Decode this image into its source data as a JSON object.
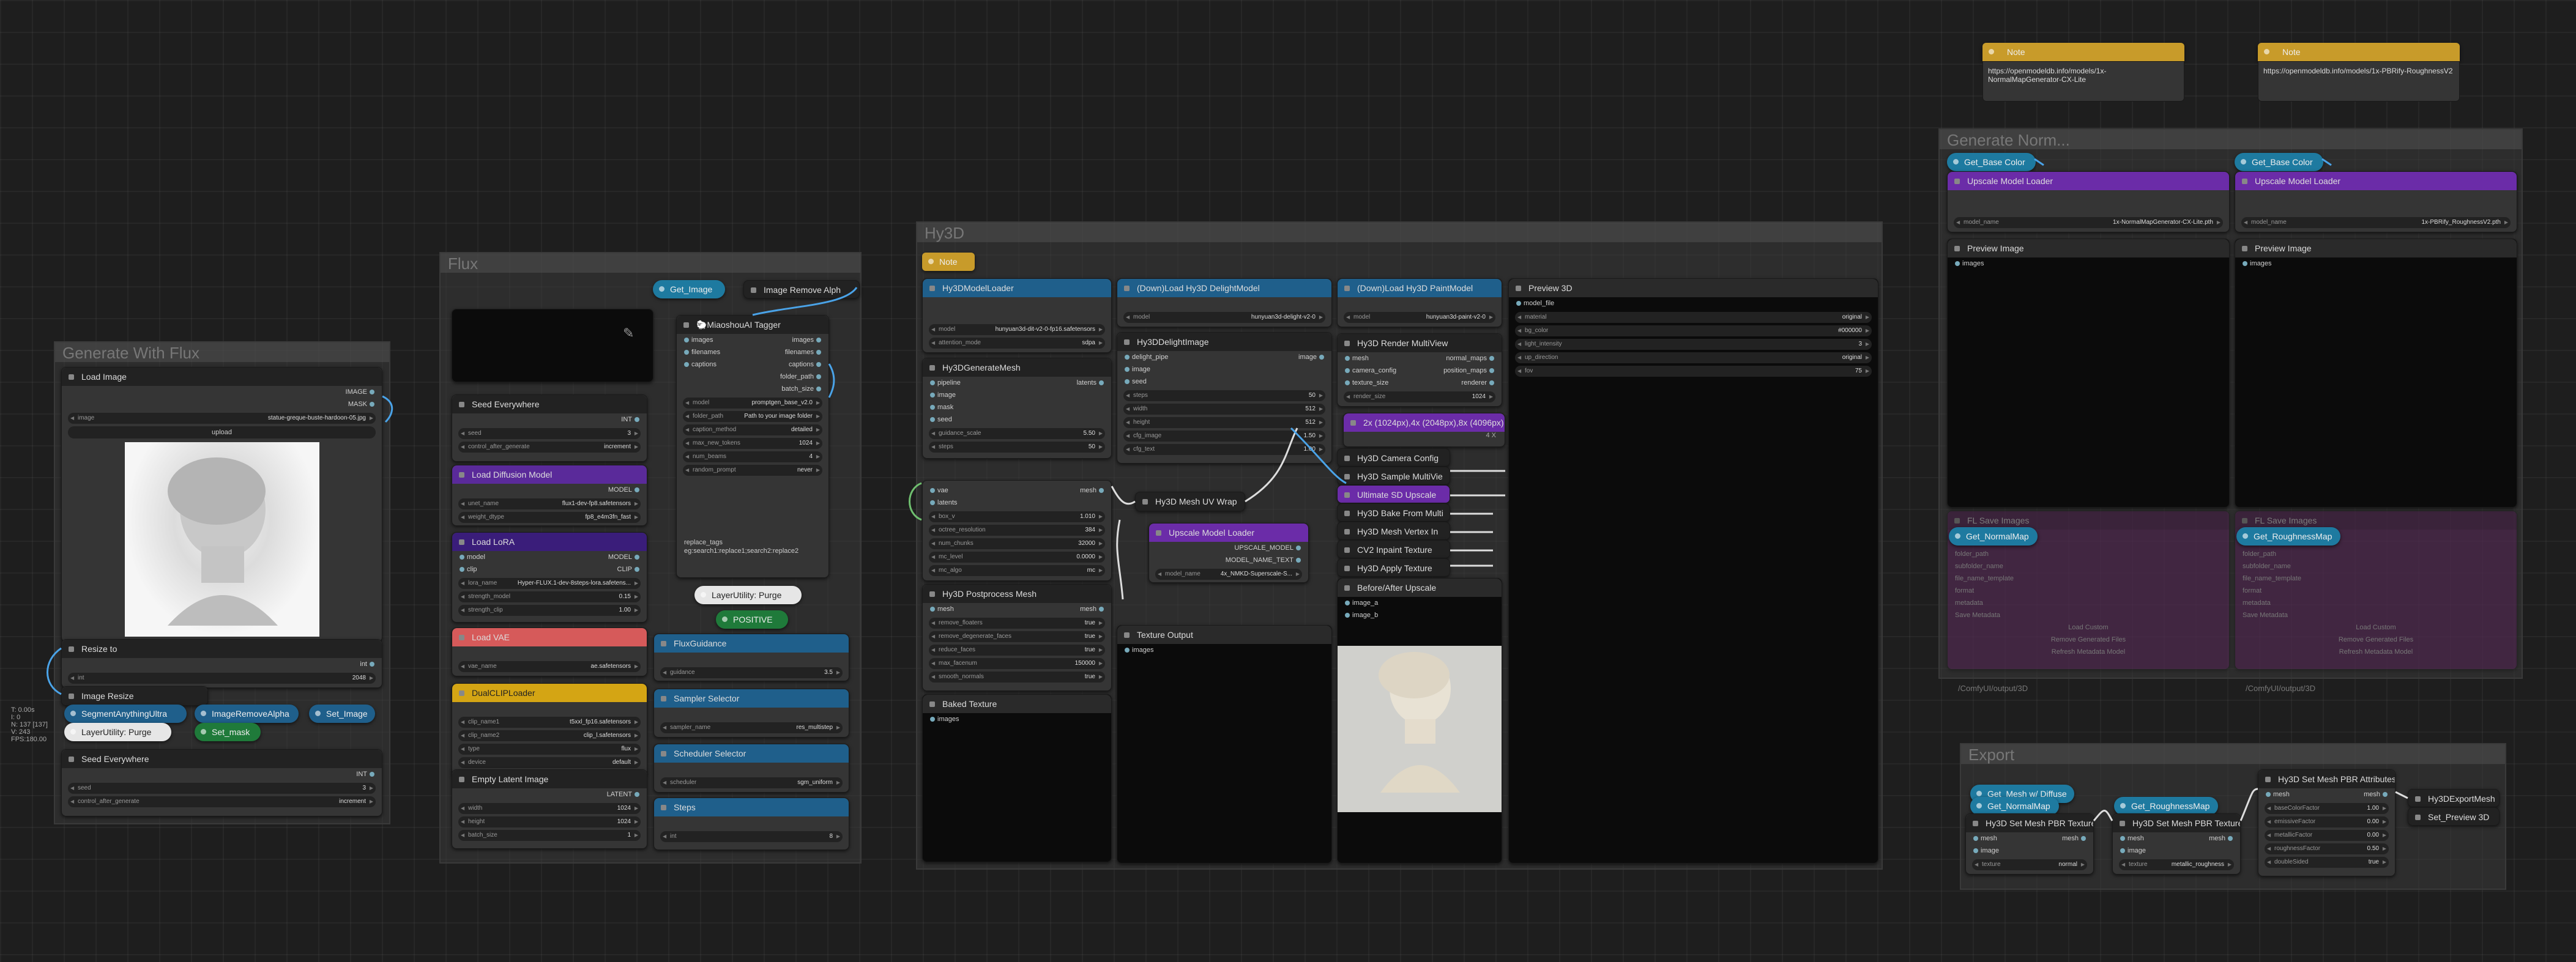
{
  "perf": [
    "T: 0.00s",
    "I: 0",
    "N: 137 [137]",
    "V: 243",
    "FPS:180.00"
  ],
  "groups": {
    "generate": "Generate With Flux",
    "flux": "Flux",
    "hy3d": "Hy3D",
    "normal": "Generate Norm...",
    "export": "Export"
  },
  "notes": {
    "badge": "Note",
    "note1": "https://openmodeldb.info/models/1x-NormalMapGenerator-CX-Lite",
    "note2": "https://openmodeldb.info/models/1x-PBRify-RoughnessV2"
  },
  "load_image": {
    "title": "Load Image",
    "out1": "IMAGE",
    "out2": "MASK",
    "widget_key": "image",
    "widget_val": "statue-greque-buste-hardoon-05.jpg",
    "upload": "upload"
  },
  "resize": {
    "title": "Resize to",
    "out": "int",
    "key": "int",
    "val": "2048"
  },
  "image_resize": {
    "title": "Image Resize"
  },
  "pills": {
    "seg": "SegmentAnythingUltra",
    "rembg": "ImageRemoveAlpha",
    "set_image": "Set_Image",
    "set_mask": "Set_mask",
    "purge1": "LayerUtility: Purge",
    "get_image": "Get_Image",
    "remove_alpha": "Image Remove Alph",
    "purge2": "LayerUtility: Purge",
    "positive": "POSITIVE",
    "get_base1": "Get_Base Color",
    "get_base2": "Get_Base Color",
    "get_normal": "Get_NormalMap",
    "get_rough": "Get_RoughnessMap",
    "path1": "/ComfyUI/output/3D",
    "path2": "/ComfyUI/output/3D",
    "get_mesh": "Get_Mesh w/ Diffuse",
    "get_normal2": "Get_NormalMap",
    "get_rough2": "Get_RoughnessMap",
    "export_mesh": "Hy3DExportMesh",
    "set_preview": "Set_Preview 3D"
  },
  "seed1": {
    "title": "Seed Everywhere",
    "out": "INT",
    "w1k": "seed",
    "w1v": "3",
    "w2k": "control_after_generate",
    "w2v": "increment"
  },
  "seed2": {
    "title": "Seed Everywhere",
    "out": "INT",
    "w1k": "seed",
    "w1v": "3",
    "w2k": "control_after_generate",
    "w2v": "increment"
  },
  "diffusion": {
    "title": "Load Diffusion Model",
    "out": "MODEL",
    "w1k": "unet_name",
    "w1v": "flux1-dev-fp8.safetensors",
    "w2k": "weight_dtype",
    "w2v": "fp8_e4m3fn_fast"
  },
  "lora": {
    "title": "Load LoRA",
    "in1": "model",
    "in2": "clip",
    "out1": "MODEL",
    "out2": "CLIP",
    "w1k": "lora_name",
    "w1v": "Hyper-FLUX.1-dev-8steps-lora.safetens...",
    "w2k": "strength_model",
    "w2v": "0.15",
    "w3k": "strength_clip",
    "w3v": "1.00"
  },
  "vae": {
    "title": "Load VAE",
    "w1k": "vae_name",
    "w1v": "ae.safetensors"
  },
  "dualclip": {
    "title": "DualCLIPLoader",
    "w1k": "clip_name1",
    "w1v": "t5xxl_fp16.safetensors",
    "w2k": "clip_name2",
    "w2v": "clip_l.safetensors",
    "w3k": "type",
    "w3v": "flux",
    "w4k": "device",
    "w4v": "default"
  },
  "latent": {
    "title": "Empty Latent Image",
    "out": "LATENT",
    "w1k": "width",
    "w1v": "1024",
    "w2k": "height",
    "w2v": "1024",
    "w3k": "batch_size",
    "w3v": "1"
  },
  "tagger": {
    "title": "🐑MiaoshouAI Tagger",
    "i1": "images",
    "i2": "filenames",
    "i3": "captions",
    "o1": "images",
    "o2": "filenames",
    "o3": "captions",
    "o4": "folder_path",
    "o5": "batch_size",
    "w1k": "model",
    "w1v": "promptgen_base_v2.0",
    "w2k": "folder_path",
    "w2v": "Path to your image folder",
    "w3k": "caption_method",
    "w3v": "detailed",
    "w4k": "max_new_tokens",
    "w4v": "1024",
    "w5k": "num_beams",
    "w5v": "4",
    "w6k": "random_prompt",
    "w6v": "never",
    "footer": "replace_tags\neg:search1:replace1;search2:replace2"
  },
  "flux_guidance": {
    "title": "FluxGuidance",
    "wk": "guidance",
    "wv": "3.5"
  },
  "sampler": {
    "title": "Sampler Selector",
    "wk": "sampler_name",
    "wv": "res_multistep"
  },
  "scheduler": {
    "title": "Scheduler Selector",
    "wk": "scheduler",
    "wv": "sgm_uniform"
  },
  "steps": {
    "title": "Steps",
    "wk": "int",
    "wv": "8"
  },
  "hy_model_loader": {
    "title": "Hy3DModelLoader",
    "w1k": "model",
    "w1v": "hunyuan3d-dit-v2-0-fp16.safetensors",
    "w2k": "attention_mode",
    "w2v": "sdpa"
  },
  "hy_gen_mesh": {
    "title": "Hy3DGenerateMesh",
    "i1": "pipeline",
    "i2": "image",
    "i3": "mask",
    "i4": "seed",
    "o1": "latents",
    "w1k": "guidance_scale",
    "w1v": "5.50",
    "w2k": "steps",
    "w2v": "50"
  },
  "vae_decode": {
    "i1": "vae",
    "i2": "latents",
    "o1": "mesh",
    "w1k": "box_v",
    "w1v": "1.010",
    "w2k": "octree_resolution",
    "w2v": "384",
    "w3k": "num_chunks",
    "w3v": "32000",
    "w4k": "mc_level",
    "w4v": "0.0000",
    "w5k": "mc_algo",
    "w5v": "mc"
  },
  "hy_postprocess": {
    "title": "Hy3D Postprocess Mesh",
    "i1": "mesh",
    "o1": "mesh",
    "w1k": "remove_floaters",
    "w1v": "true",
    "w2k": "remove_degenerate_faces",
    "w2v": "true",
    "w3k": "reduce_faces",
    "w3v": "true",
    "w4k": "max_facenum",
    "w4v": "150000",
    "w5k": "smooth_normals",
    "w5v": "true"
  },
  "baked": {
    "title": "Baked Texture",
    "i1": "images"
  },
  "delight_model": {
    "title": "(Down)Load Hy3D DelightModel",
    "wk": "model",
    "wv": "hunyuan3d-delight-v2-0"
  },
  "delight_image": {
    "title": "Hy3DDelightImage",
    "i1": "delight_pipe",
    "i2": "image",
    "i3": "seed",
    "o1": "image",
    "w1k": "steps",
    "w1v": "50",
    "w2k": "width",
    "w2v": "512",
    "w3k": "height",
    "w3v": "512",
    "w4k": "cfg_image",
    "w4v": "1.50",
    "w5k": "cfg_text",
    "w5v": "1.00"
  },
  "uv_wrap": {
    "title": "Hy3D Mesh UV Wrap"
  },
  "upscale_loader": {
    "title": "Upscale Model Loader",
    "o1": "UPSCALE_MODEL",
    "o2": "MODEL_NAME_TEXT",
    "wk": "model_name",
    "wv": "4x_NMKD-Superscale-S..."
  },
  "texture_output": {
    "title": "Texture Output",
    "i1": "images"
  },
  "paint_model": {
    "title": "(Down)Load Hy3D PaintModel",
    "wk": "model",
    "wv": "hunyuan3d-paint-v2-0"
  },
  "render_multiview": {
    "title": "Hy3D Render MultiView",
    "i1": "mesh",
    "i2": "camera_config",
    "i3": "texture_size",
    "o1": "normal_maps",
    "o2": "position_maps",
    "o3": "renderer",
    "w1k": "render_size",
    "w1v": "1024"
  },
  "upscale_select": {
    "title": "2x (1024px),4x (2048px),8x (4096px)",
    "x": "4 X"
  },
  "hy_small": [
    "Hy3D Camera Config",
    "Hy3D Sample MultiVie",
    "Ultimate SD Upscale",
    "Hy3D Bake From Multi",
    "Hy3D Mesh Vertex In",
    "CV2 Inpaint Texture",
    "Hy3D Apply Texture"
  ],
  "before_after": {
    "title": "Before/After Upscale",
    "i1": "image_a",
    "i2": "image_b"
  },
  "preview3d": {
    "title": "Preview 3D",
    "i1": "model_file",
    "w1k": "material",
    "w1v": "original",
    "w2k": "bg_color",
    "w2v": "#000000",
    "w3k": "light_intensity",
    "w3v": "3",
    "w4k": "up_direction",
    "w4v": "original",
    "w5k": "fov",
    "w5v": "75"
  },
  "upscale_model_a": {
    "title": "Upscale Model Loader",
    "wk": "model_name",
    "wv": "1x-NormalMapGenerator-CX-Lite.pth"
  },
  "upscale_model_b": {
    "title": "Upscale Model Loader",
    "wk": "model_name",
    "wv": "1x-PBRify_RoughnessV2.pth"
  },
  "preview_a": {
    "title": "Preview Image",
    "i1": "images"
  },
  "preview_b": {
    "title": "Preview Image",
    "i1": "images"
  },
  "save_a": {
    "title": "FL Save Images",
    "rows": [
      "images",
      "folder_path",
      "subfolder_name",
      "file_name_template",
      "format",
      "metadata",
      "Save Metadata",
      "Load Custom",
      "Remove Generated Files",
      "Refresh Metadata Model"
    ]
  },
  "save_b": {
    "title": "FL Save Images",
    "rows": [
      "images",
      "folder_path",
      "subfolder_name",
      "file_name_template",
      "format",
      "metadata",
      "Save Metadata",
      "Load Custom",
      "Remove Generated Files",
      "Refresh Metadata Model"
    ]
  },
  "pbr_a": {
    "title": "Hy3D Set Mesh PBR Textures",
    "i1": "mesh",
    "i2": "image",
    "o1": "mesh",
    "wk": "texture",
    "wv": "normal"
  },
  "pbr_b": {
    "title": "Hy3D Set Mesh PBR Textures",
    "i1": "mesh",
    "i2": "image",
    "o1": "mesh",
    "wk": "texture",
    "wv": "metallic_roughness"
  },
  "pbr_attr": {
    "title": "Hy3D Set Mesh PBR Attributes",
    "i1": "mesh",
    "o1": "mesh",
    "w1k": "baseColorFactor",
    "w1v": "1.00",
    "w2k": "emissiveFactor",
    "w2v": "0.00",
    "w3k": "metallicFactor",
    "w3v": "0.00",
    "w4k": "roughnessFactor",
    "w4v": "0.50",
    "w5k": "doubleSided",
    "w5v": "true"
  },
  "colors": {
    "blue": "#1f5f8b",
    "purple": "#6b2ca8",
    "yellow": "#d4a514",
    "green": "#1f7a3a",
    "red": "#d65a5a",
    "teal": "#1e7aa0",
    "gold": "#c89b2a"
  }
}
